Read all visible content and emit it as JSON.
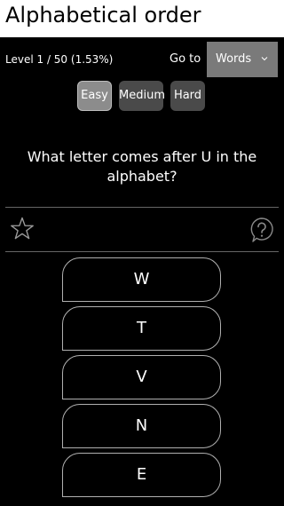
{
  "header": {
    "title": "Alphabetical order"
  },
  "status": {
    "progress": "Level 1 / 50 (1.53%)",
    "goto_label": "Go to"
  },
  "goto_select": {
    "selected": "Words"
  },
  "difficulty": {
    "easy": "Easy",
    "medium": "Medium",
    "hard": "Hard",
    "selected": "Easy"
  },
  "question": {
    "text": "What letter comes after U in the alphabet?"
  },
  "icons": {
    "favorite": "star-icon",
    "help": "question-icon"
  },
  "answers": [
    "W",
    "T",
    "V",
    "N",
    "E"
  ],
  "colors": {
    "background": "#000000",
    "title_bar": "#ffffff",
    "active_tab": "#8c8c8c",
    "inactive_tab": "#4a4a4a",
    "dropdown": "#7a7a7a"
  }
}
